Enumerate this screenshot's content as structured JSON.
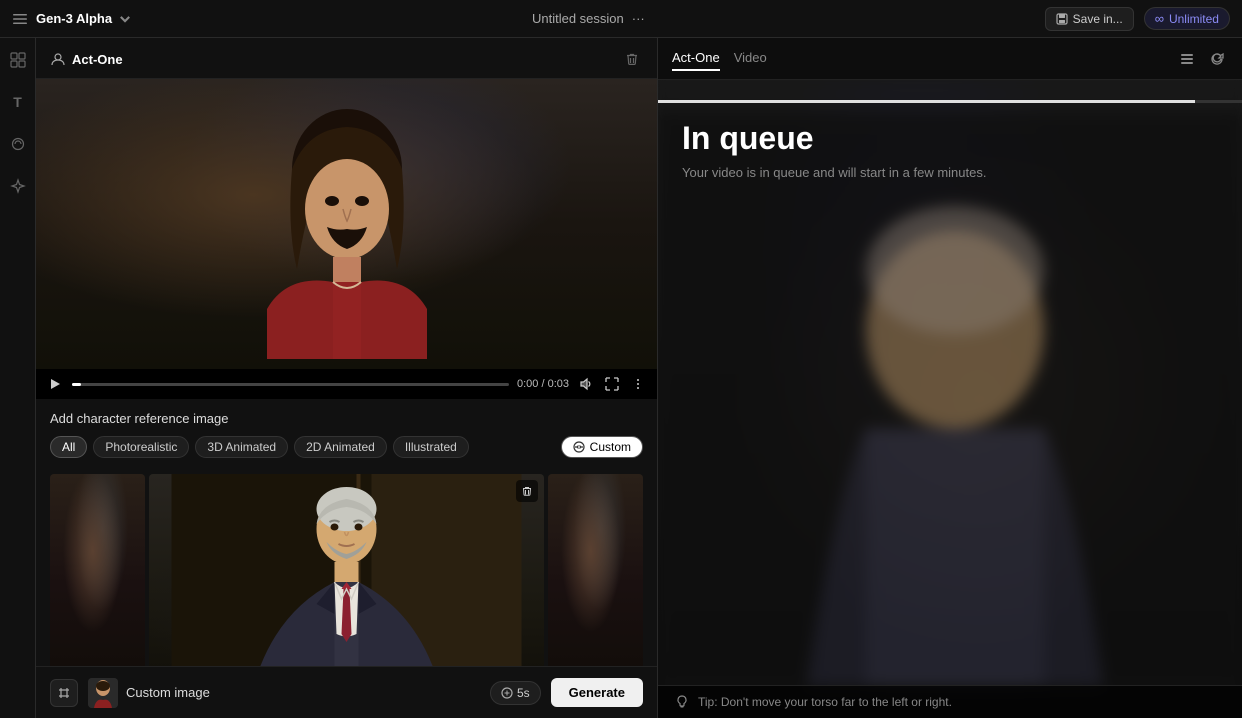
{
  "app": {
    "brand": "Gen-3 Alpha",
    "session_title": "Untitled session",
    "session_dots": "···",
    "save_label": "Save in...",
    "unlimited_label": "Unlimited"
  },
  "left_panel": {
    "act_one_label": "Act-One",
    "video": {
      "time_current": "0:00",
      "time_total": "0:03",
      "progress_pct": 2
    },
    "char_ref": {
      "title": "Add character reference image",
      "filters": [
        "All",
        "Photorealistic",
        "3D Animated",
        "2D Animated",
        "Illustrated"
      ],
      "active_filter": "All",
      "custom_label": "Custom"
    },
    "bottom_bar": {
      "custom_image_label": "Custom image",
      "credits_label": "5s",
      "generate_label": "Generate"
    }
  },
  "right_panel": {
    "tabs": [
      "Act-One",
      "Video"
    ],
    "active_tab": "Act-One",
    "queue": {
      "title": "In queue",
      "subtitle": "Your video is in queue and will start in a few minutes.",
      "progress_pct": 92
    },
    "tip": {
      "text": "Tip: Don't move your torso far to the left or right."
    }
  },
  "icons": {
    "grid": "⊞",
    "text": "T",
    "share": "⟳",
    "magic": "✦",
    "play": "▶",
    "volume": "🔊",
    "fullscreen": "⛶",
    "more": "⋮",
    "delete": "🗑",
    "paperclip": "📎",
    "list": "≡",
    "refresh": "↻",
    "settings": "⚙",
    "tip_icon": "🎓",
    "save_icon": "💾",
    "infinity": "∞",
    "sliders": "⚙"
  }
}
